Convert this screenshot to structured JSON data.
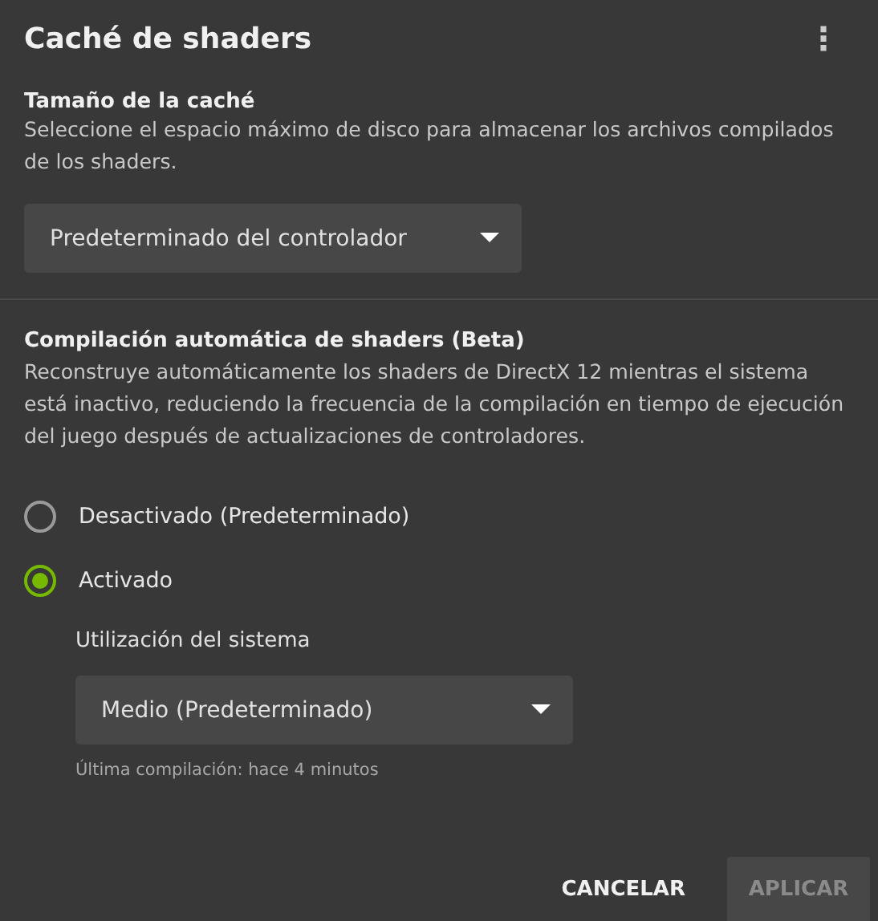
{
  "dialog": {
    "title": "Caché de shaders",
    "menu_icon": "⋮"
  },
  "cache_size": {
    "heading": "Tamaño de la caché",
    "description": "Seleccione el espacio máximo de disco para almacenar los archivos compilados de los shaders.",
    "dropdown": {
      "value": "Predeterminado del controlador"
    }
  },
  "auto_compile": {
    "heading": "Compilación automática de shaders (Beta)",
    "description": "Reconstruye automáticamente los shaders de DirectX 12 mientras el sistema está inactivo, reduciendo la frecuencia de la compilación en tiempo de ejecución del juego después de actualizaciones de controladores.",
    "options": [
      {
        "label": "Desactivado (Predeterminado)",
        "selected": false
      },
      {
        "label": "Activado",
        "selected": true
      }
    ],
    "usage_label": "Utilización del sistema",
    "usage_dropdown": {
      "value": "Medio (Predeterminado)"
    },
    "last_compile": "Última compilación: hace 4 minutos"
  },
  "buttons": [
    {
      "label": "CANCELAR",
      "kind": "text",
      "disabled": false
    },
    {
      "label": "APLICAR",
      "kind": "filled",
      "disabled": true
    }
  ]
}
